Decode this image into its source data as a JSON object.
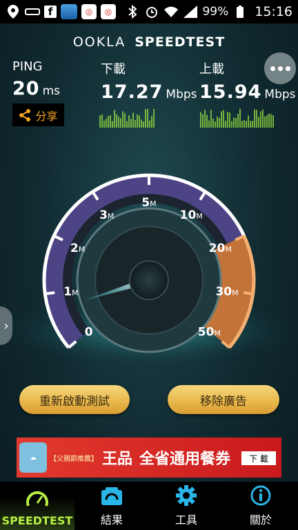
{
  "status_bar": {
    "battery": "99%",
    "time": "15:16",
    "fb_label": "f"
  },
  "header": {
    "brand_ookla": "OOKLA",
    "brand_speedtest": "SPEEDTEST"
  },
  "metrics": {
    "ping": {
      "label": "PING",
      "value": "20",
      "unit": "ms"
    },
    "download": {
      "label": "下載",
      "value": "17.27",
      "unit": "Mbps"
    },
    "upload": {
      "label": "上載",
      "value": "15.94",
      "unit": "Mbps"
    }
  },
  "share": {
    "label": "分享"
  },
  "gauge": {
    "ticks": [
      {
        "value": "0",
        "unit": ""
      },
      {
        "value": "1",
        "unit": "M"
      },
      {
        "value": "2",
        "unit": "M"
      },
      {
        "value": "3",
        "unit": "M"
      },
      {
        "value": "5",
        "unit": "M"
      },
      {
        "value": "10",
        "unit": "M"
      },
      {
        "value": "20",
        "unit": "M"
      },
      {
        "value": "30",
        "unit": "M"
      },
      {
        "value": "50",
        "unit": "M"
      }
    ],
    "needle_value_mbps": 0.7
  },
  "buttons": {
    "restart": "重新啟動測試",
    "remove_ads": "移除廣告"
  },
  "ad": {
    "promo": "【父親節推薦】",
    "brand": "王品",
    "headline": "全省通用餐券",
    "download": "下 載"
  },
  "nav": {
    "items": [
      {
        "label": "SPEEDTEST",
        "icon": "speedometer-icon"
      },
      {
        "label": "結果",
        "icon": "results-icon"
      },
      {
        "label": "工具",
        "icon": "gear-icon"
      },
      {
        "label": "關於",
        "icon": "info-icon"
      }
    ]
  },
  "colors": {
    "accent_green": "#b7f043",
    "accent_orange": "#f5a623",
    "gauge_purple": "#8a6cf0",
    "gauge_orange": "#e0803a"
  }
}
